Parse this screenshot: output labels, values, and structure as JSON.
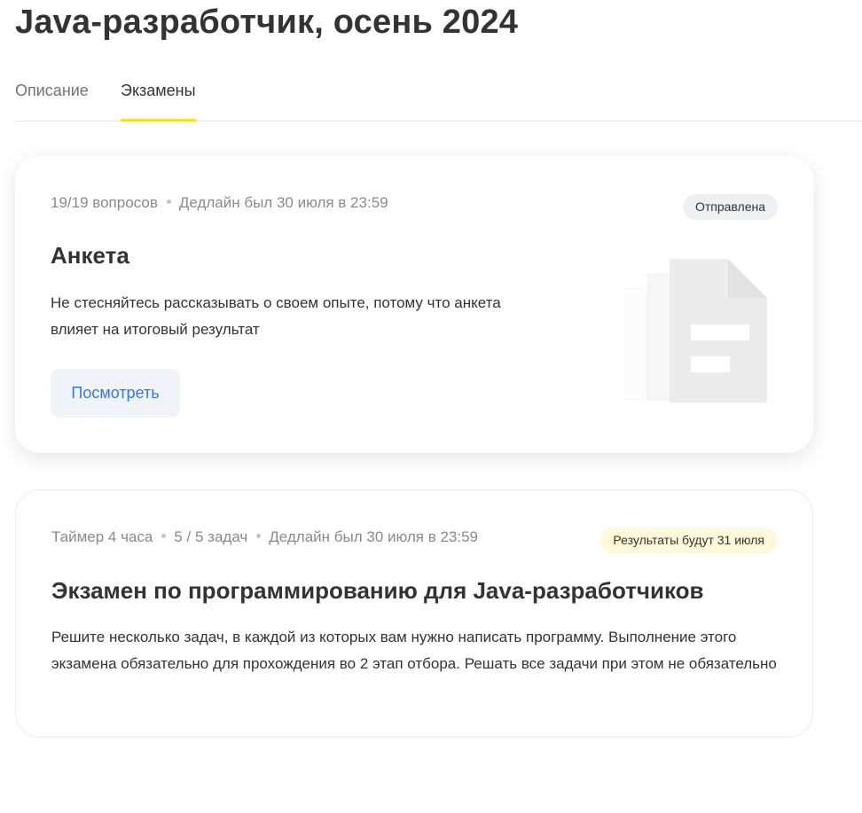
{
  "page": {
    "title": "Java-разработчик, осень 2024"
  },
  "tabs": [
    {
      "label": "Описание",
      "active": false
    },
    {
      "label": "Экзамены",
      "active": true
    }
  ],
  "colors": {
    "accent": "#ffdd2d",
    "link": "#3677e0",
    "badge_sent_bg": "#eef0f3",
    "badge_results_bg": "#fff8d9"
  },
  "cards": [
    {
      "meta": [
        "19/19 вопросов",
        "Дедлайн был 30 июля в 23:59"
      ],
      "badge": "Отправлена",
      "title": "Анкета",
      "description": "Не стесняйтесь рассказывать о своем опыте, потому что анкета влияет на итоговый результат",
      "button_label": "Посмотреть",
      "illustration": "document-stack-icon"
    },
    {
      "meta": [
        "Таймер 4 часа",
        "5 / 5 задач",
        "Дедлайн был 30 июля в 23:59"
      ],
      "badge": "Результаты будут 31 июля",
      "title": "Экзамен по программированию для Java-разработчиков",
      "description": "Решите несколько задач, в каждой из которых вам нужно написать программу. Выполнение этого экзамена обязательно для прохождения во 2 этап отбора. Решать все задачи при этом не обязательно"
    }
  ]
}
